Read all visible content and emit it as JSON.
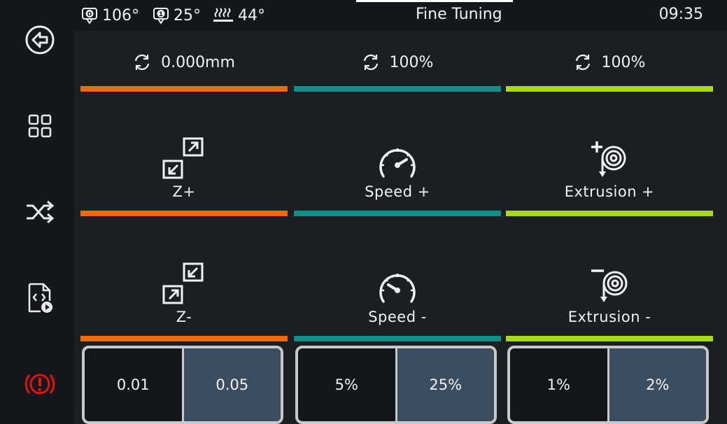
{
  "colors": {
    "z_accent": "#f06a0c",
    "speed_accent": "#0f8f86",
    "extrusion_accent": "#a8db18",
    "emergency": "#e01414",
    "selected_step_bg": "#3b4d60"
  },
  "sidebar": {
    "items": [
      {
        "name": "back",
        "icon": "back-arrow-icon"
      },
      {
        "name": "menu",
        "icon": "grid-icon"
      },
      {
        "name": "macros",
        "icon": "shuffle-icon"
      },
      {
        "name": "console",
        "icon": "file-code-play-icon"
      },
      {
        "name": "emergency-stop",
        "icon": "emergency-stop-icon"
      }
    ]
  },
  "topbar": {
    "extruder0_temp": "106°",
    "extruder1_temp": "25°",
    "bed_temp": "44°",
    "title": "Fine Tuning",
    "time": "09:35"
  },
  "z": {
    "offset": "0.000mm",
    "up_label": "Z+",
    "down_label": "Z-",
    "steps": [
      "0.01",
      "0.05"
    ],
    "selected_step": "0.05"
  },
  "speed": {
    "factor": "100%",
    "up_label": "Speed +",
    "down_label": "Speed -",
    "steps": [
      "5%",
      "25%"
    ],
    "selected_step": "25%"
  },
  "extrusion": {
    "factor": "100%",
    "up_label": "Extrusion +",
    "down_label": "Extrusion -",
    "steps": [
      "1%",
      "2%"
    ],
    "selected_step": "2%"
  }
}
